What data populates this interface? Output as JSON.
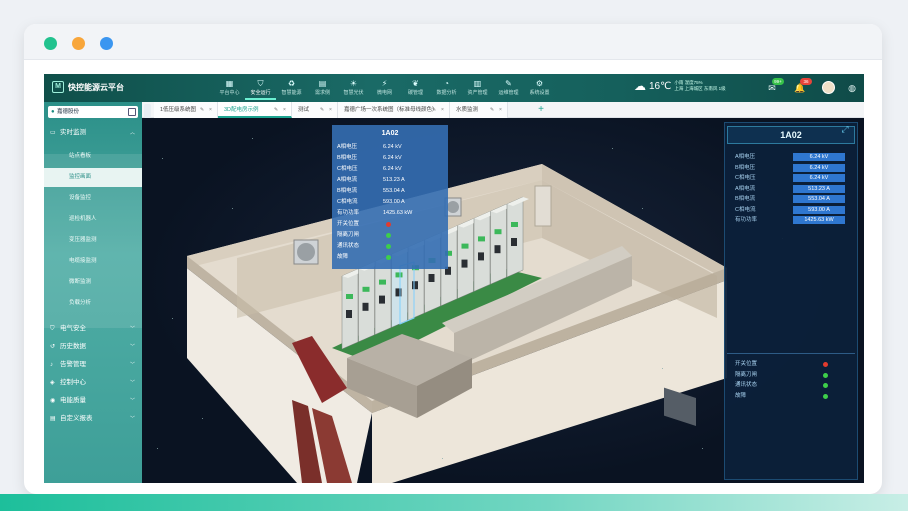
{
  "app": {
    "title": "快控能源云平台"
  },
  "nav": [
    {
      "label": "平台中心",
      "icon": "grid-icon"
    },
    {
      "label": "安全运行",
      "icon": "shield-icon",
      "active": true
    },
    {
      "label": "智慧能源",
      "icon": "recycle-icon"
    },
    {
      "label": "需求侧",
      "icon": "chart-icon"
    },
    {
      "label": "智慧光伏",
      "icon": "solar-icon"
    },
    {
      "label": "微电网",
      "icon": "grid-power-icon"
    },
    {
      "label": "碳管理",
      "icon": "leaf-icon"
    },
    {
      "label": "数据分析",
      "icon": "pie-icon"
    },
    {
      "label": "资产管理",
      "icon": "database-icon"
    },
    {
      "label": "运维管理",
      "icon": "wrench-icon"
    },
    {
      "label": "系统设置",
      "icon": "gear-icon"
    }
  ],
  "weather": {
    "temp": "16℃",
    "desc": "小雨 湿度75%",
    "location": "上海 上海城区 东南风 1级"
  },
  "notifications": {
    "messages": "99+",
    "alerts": "36"
  },
  "sidebar": {
    "site": "嘉德股份",
    "groups": [
      {
        "label": "实时监测",
        "icon": "monitor-icon",
        "expanded": true,
        "items": [
          "站点看板",
          "监控画面",
          "设备监控",
          "巡检机器人",
          "变压器监测",
          "电缆接监测",
          "微断监测",
          "负载分析"
        ],
        "active_item": "监控画面"
      },
      {
        "label": "电气安全",
        "icon": "shield-icon"
      },
      {
        "label": "历史数据",
        "icon": "history-icon"
      },
      {
        "label": "告警管理",
        "icon": "bell-icon"
      },
      {
        "label": "控制中心",
        "icon": "control-icon"
      },
      {
        "label": "电能质量",
        "icon": "power-icon"
      },
      {
        "label": "自定义报表",
        "icon": "report-icon"
      }
    ]
  },
  "tabs": [
    {
      "label": "1低压级系统图"
    },
    {
      "label": "3D配电房示例",
      "active": true
    },
    {
      "label": "测试"
    },
    {
      "label": "嘉德广场一次系统图（标准母线颜色）"
    },
    {
      "label": "水质监测"
    }
  ],
  "tooltip": {
    "title": "1A02",
    "rows": [
      {
        "label": "A相电压",
        "value": "6.24 kV"
      },
      {
        "label": "B相电压",
        "value": "6.24 kV"
      },
      {
        "label": "C相电压",
        "value": "6.24 kV"
      },
      {
        "label": "A相电流",
        "value": "513.23 A"
      },
      {
        "label": "B相电流",
        "value": "553.04 A"
      },
      {
        "label": "C相电流",
        "value": "593.00 A"
      },
      {
        "label": "有功功率",
        "value": "1425.63 kW"
      }
    ],
    "status": [
      {
        "label": "开关位置",
        "color": "#e23b2e"
      },
      {
        "label": "隔离刀闸",
        "color": "#3dcf4a"
      },
      {
        "label": "通讯状态",
        "color": "#3dcf4a"
      },
      {
        "label": "故障",
        "color": "#3dcf4a"
      }
    ]
  },
  "panel": {
    "title": "1A02",
    "rows": [
      {
        "label": "A相电压",
        "value": "6.24 kV"
      },
      {
        "label": "B相电压",
        "value": "6.24 kV"
      },
      {
        "label": "C相电压",
        "value": "6.24 kV"
      },
      {
        "label": "A相电流",
        "value": "513.23 A"
      },
      {
        "label": "B相电流",
        "value": "553.04 A"
      },
      {
        "label": "C相电流",
        "value": "593.00 A"
      },
      {
        "label": "有功功率",
        "value": "1425.63 kW"
      }
    ],
    "status": [
      {
        "label": "开关位置",
        "color": "#e23b2e"
      },
      {
        "label": "隔离刀闸",
        "color": "#3dcf4a"
      },
      {
        "label": "通讯状态",
        "color": "#3dcf4a"
      },
      {
        "label": "故障",
        "color": "#3dcf4a"
      }
    ]
  },
  "colors": {
    "accent": "#1fa592",
    "sidebar": "#3e9f98",
    "panel_value": "#2f77d0"
  }
}
